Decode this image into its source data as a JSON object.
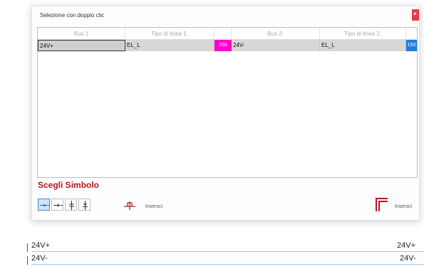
{
  "dialog": {
    "title": "Selezione con doppio clic",
    "close_icon": "close-icon"
  },
  "grid": {
    "headers": [
      "Bus 1",
      "Tipo di linea 1:",
      "",
      "Bus 2:",
      "Tipo di linea 2:",
      ""
    ],
    "row": {
      "bus1": "24V+",
      "line_type1": "EL_L",
      "color1": "#ff00cc",
      "color1_label": "255",
      "bus2": "24V-",
      "line_type2": "EL_L",
      "color2": "#1e7fe0",
      "color2_label": "150"
    }
  },
  "symbol_panel": {
    "title": "Scegli Simbolo",
    "buttons": [
      {
        "icon": "line-break-symbol-icon",
        "active": true
      },
      {
        "icon": "arrow-break-symbol-icon",
        "active": false
      },
      {
        "icon": "vertical-break-symbol-icon",
        "active": false
      },
      {
        "icon": "vertical-arrow-symbol-icon",
        "active": false
      }
    ],
    "insert_left_label": "Insersci",
    "insert_right_label": "Insersci",
    "bridge_icon": "wire-bridge-icon",
    "corner_icon": "wire-corner-icon"
  },
  "wires": {
    "left_top": "24V+",
    "left_bottom": "24V-",
    "right_top": "24V+",
    "right_bottom": "24V-",
    "top_color": "#f0a0d8",
    "bottom_color": "#9cc6ec"
  }
}
